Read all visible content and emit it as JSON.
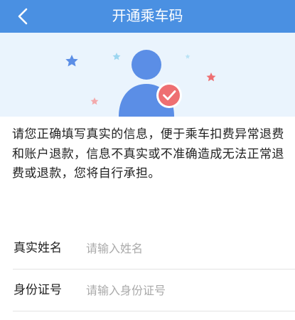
{
  "header": {
    "title": "开通乘车码",
    "back_icon": "chevron-left-icon",
    "background_color": "#4a90e2"
  },
  "hero": {
    "background_color": "#eaf4fd",
    "avatar_icon": "user-avatar-icon",
    "check_badge_icon": "check-badge-icon",
    "star_icons": [
      "star-icon-blue",
      "star-icon-lightblue",
      "star-icon-red",
      "star-icon-pink"
    ],
    "colors": {
      "avatar": "#5b8ee6",
      "badge": "#ee6f72",
      "star_blue": "#5b8ee6",
      "star_red": "#ee6f72"
    }
  },
  "notice": {
    "text": "请您正确填写真实的信息，便于乘车扣费异常退费和账户退款，信息不真实或不准确造成无法正常退费或退款，您将自行承担。"
  },
  "form": {
    "name": {
      "label": "真实姓名",
      "placeholder": "请输入姓名",
      "value": ""
    },
    "id_number": {
      "label": "身份证号",
      "placeholder": "请输入身份证号",
      "value": ""
    }
  }
}
